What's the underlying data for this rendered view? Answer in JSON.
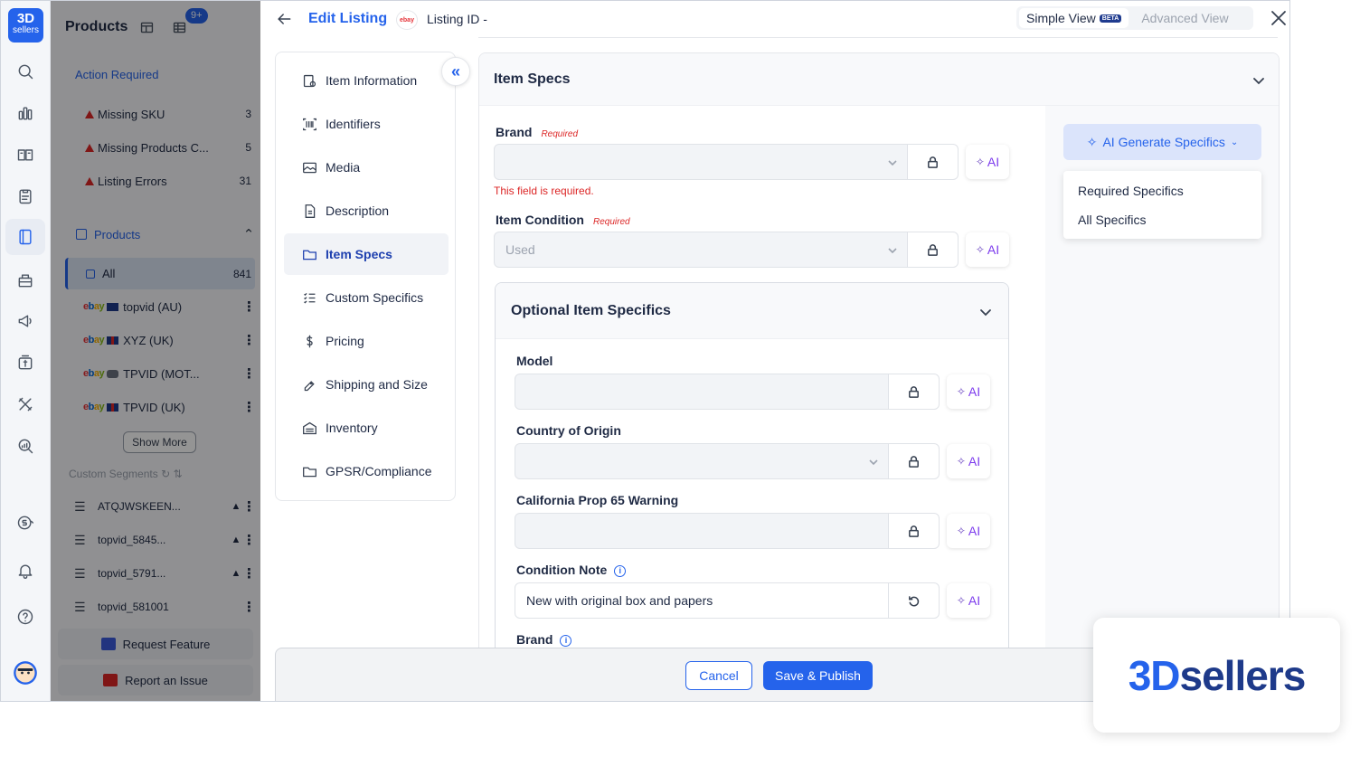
{
  "rail": {
    "logo_top": "3D",
    "logo_bottom": "sellers",
    "icons": [
      "search-icon",
      "analytics-icon",
      "orders-icon",
      "clipboard-icon",
      "listings-icon",
      "inventory-icon",
      "marketing-icon",
      "repricer-icon",
      "tools-icon",
      "reports-icon",
      "subscription-icon",
      "bell-icon",
      "help-icon",
      "user-avatar"
    ]
  },
  "panel": {
    "title": "Products",
    "notif_badge": "9+",
    "action_required_title": "Action Required",
    "action_items": [
      {
        "label": "Missing SKU",
        "count": "3"
      },
      {
        "label": "Missing Products C...",
        "count": "5"
      },
      {
        "label": "Listing Errors",
        "count": "31"
      }
    ],
    "products_title": "Products",
    "all_label": "All",
    "all_count": "841",
    "stores": [
      {
        "label": "topvid (AU)",
        "flag": "au"
      },
      {
        "label": "XYZ (UK)",
        "flag": "uk"
      },
      {
        "label": "TPVID (MOT...",
        "flag": "motors"
      },
      {
        "label": "TPVID (UK)",
        "flag": "uk"
      }
    ],
    "show_more": "Show More",
    "custom_segments_title": "Custom Segments",
    "segments": [
      {
        "label": "ATQJWSKEEN...",
        "pinned": true
      },
      {
        "label": "topvid_5845...",
        "pinned": true
      },
      {
        "label": "topvid_5791...",
        "pinned": true
      },
      {
        "label": "topvid_581001",
        "pinned": false
      }
    ],
    "request_feature": "Request Feature",
    "report_issue": "Report an Issue"
  },
  "header": {
    "title": "Edit Listing",
    "marketplace": "ebay",
    "listing_id": "Listing ID -",
    "simple_view": "Simple View",
    "beta": "BETA",
    "advanced_view": "Advanced View"
  },
  "nav": [
    {
      "label": "Item Information",
      "icon": "info-icon",
      "selected": false
    },
    {
      "label": "Identifiers",
      "icon": "barcode-icon",
      "selected": false
    },
    {
      "label": "Media",
      "icon": "image-icon",
      "selected": false
    },
    {
      "label": "Description",
      "icon": "document-icon",
      "selected": false
    },
    {
      "label": "Item Specs",
      "icon": "folder-icon",
      "selected": true
    },
    {
      "label": "Custom Specifics",
      "icon": "checklist-icon",
      "selected": false
    },
    {
      "label": "Pricing",
      "icon": "dollar-icon",
      "selected": false
    },
    {
      "label": "Shipping and Size",
      "icon": "tag-icon",
      "selected": false
    },
    {
      "label": "Inventory",
      "icon": "warehouse-icon",
      "selected": false
    },
    {
      "label": "GPSR/Compliance",
      "icon": "folder-icon",
      "selected": false
    }
  ],
  "item_specs": {
    "title": "Item Specs",
    "ai_button": "AI Generate Specifics",
    "ai_menu": [
      "Required Specifics",
      "All Specifics"
    ],
    "ai_label": "AI",
    "required_tag": "Required",
    "brand_label": "Brand",
    "brand_value": "",
    "brand_error": "This field is required.",
    "condition_label": "Item Condition",
    "condition_value": "Used",
    "optional_title": "Optional Item Specifics",
    "model_label": "Model",
    "country_label": "Country of Origin",
    "prop65_label": "California Prop 65 Warning",
    "condition_note_label": "Condition Note",
    "condition_note_value": "New with original box and papers",
    "brand2_label": "Brand"
  },
  "footer": {
    "cancel": "Cancel",
    "save": "Save & Publish"
  },
  "watermark": {
    "part1": "3D",
    "part2": "sellers"
  }
}
